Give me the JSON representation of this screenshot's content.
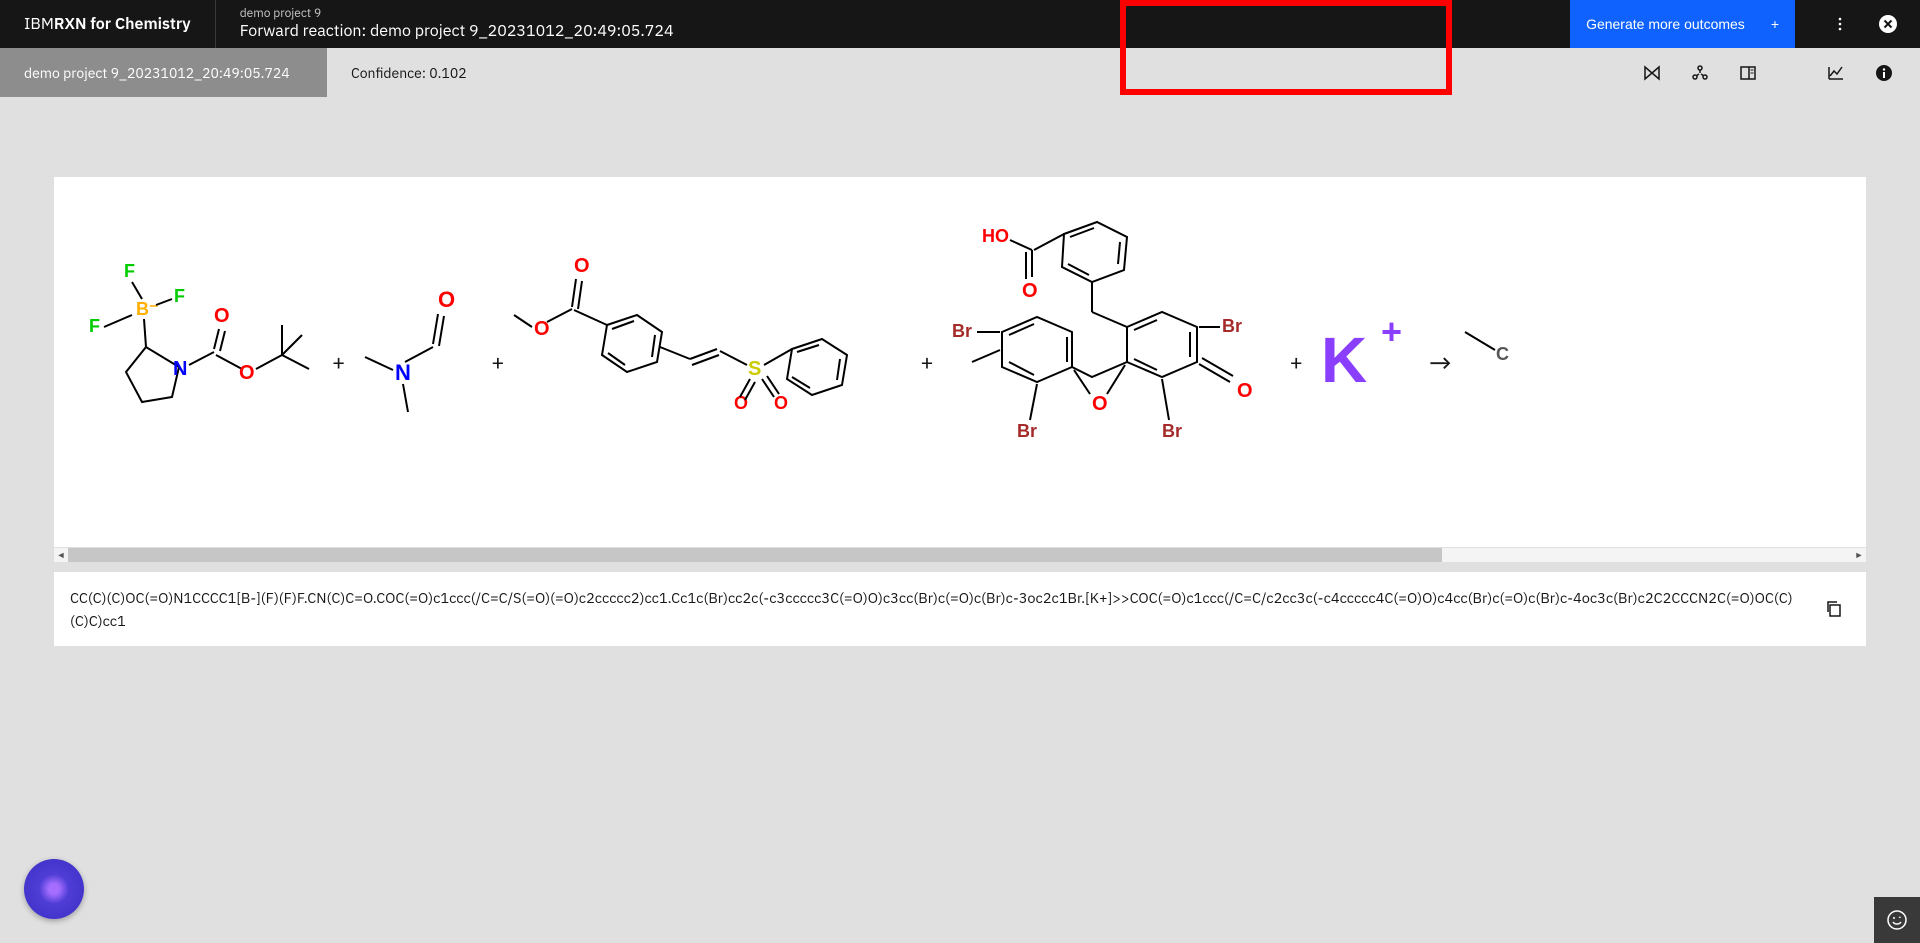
{
  "header": {
    "logo_ibm": "IBM",
    "logo_rxn": " RXN for Chemistry",
    "breadcrumb_top": "demo project 9",
    "breadcrumb_bottom": "Forward reaction: demo project 9_20231012_20:49:05.724",
    "generate_label": "Generate more outcomes"
  },
  "subheader": {
    "tab_label": "demo project 9_20231012_20:49:05.724",
    "confidence_label": "Confidence: 0.102"
  },
  "smiles": "CC(C)(C)OC(=O)N1CCCC1[B-](F)(F)F.CN(C)C=O.COC(=O)c1ccc(/C=C/S(=O)(=O)c2ccccc2)cc1.Cc1c(Br)cc2c(-c3ccccc3C(=O)O)c3cc(Br)c(=O)c(Br)c-3oc2c1Br.[K+]>>COC(=O)c1ccc(/C=C/c2cc3c(-c4ccccc4C(=O)O)c4cc(Br)c(=O)c(Br)c-4oc3c(Br)c2C2CCCN2C(=O)OC(C)(C)C)cc1",
  "chart_data": {
    "type": "reaction",
    "reactants": [
      "CC(C)(C)OC(=O)N1CCCC1[B-](F)(F)F",
      "CN(C)C=O",
      "COC(=O)c1ccc(/C=C/S(=O)(=O)c2ccccc2)cc1",
      "Cc1c(Br)cc2c(-c3ccccc3C(=O)O)c3cc(Br)c(=O)c(Br)c-3oc2c1Br",
      "[K+]"
    ],
    "products": [
      "COC(=O)c1ccc(/C=C/c2cc3c(-c4ccccc4C(=O)O)c4cc(Br)c(=O)c(Br)c-4oc3c(Br)c2C2CCCN2C(=O)OC(C)(C)C)cc1"
    ],
    "confidence": 0.102
  }
}
